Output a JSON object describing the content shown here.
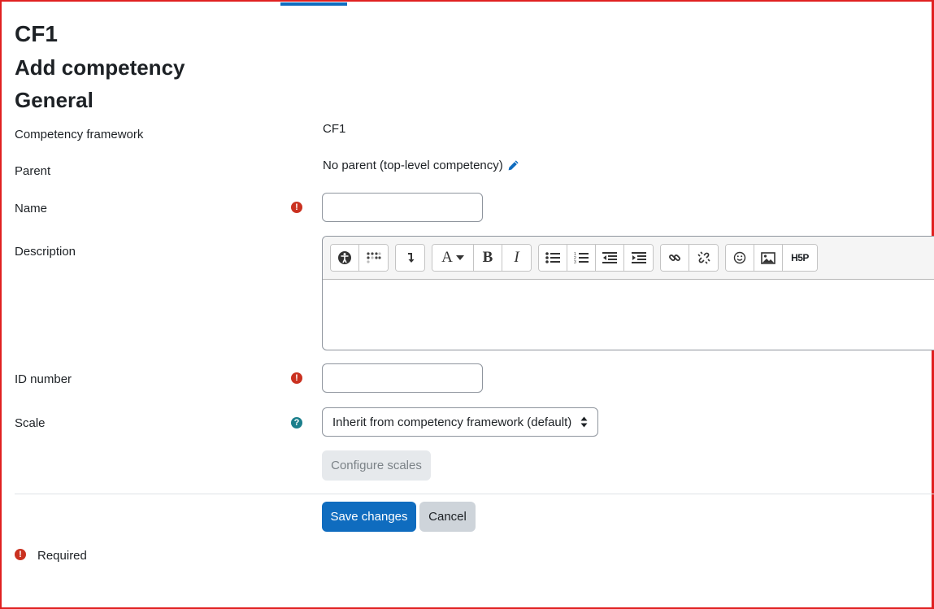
{
  "page": {
    "heading": "CF1",
    "subheading": "Add competency",
    "section": "General"
  },
  "form": {
    "framework": {
      "label": "Competency framework",
      "value": "CF1"
    },
    "parent": {
      "label": "Parent",
      "value": "No parent (top-level competency)",
      "edit_icon": "pencil-icon"
    },
    "name": {
      "label": "Name",
      "value": "",
      "placeholder": ""
    },
    "description": {
      "label": "Description",
      "value": ""
    },
    "idnumber": {
      "label": "ID number",
      "value": "",
      "placeholder": ""
    },
    "scale": {
      "label": "Scale",
      "selected": "Inherit from competency framework (default)"
    },
    "configure_scales": "Configure scales",
    "save": "Save changes",
    "cancel": "Cancel",
    "required_legend": "Required",
    "required_icon": "!",
    "help_icon": "?"
  },
  "toolbar": {
    "groups": [
      [
        "accessibility-checker-icon",
        "screenreader-helper-icon"
      ],
      [
        "show-more-icon"
      ],
      [
        "font-style-icon",
        "bold-icon",
        "italic-icon"
      ],
      [
        "unordered-list-icon",
        "ordered-list-icon",
        "outdent-icon",
        "indent-icon"
      ],
      [
        "link-icon",
        "unlink-icon"
      ],
      [
        "emoji-icon",
        "image-icon",
        "h5p-icon"
      ]
    ],
    "bold_glyph": "B",
    "italic_glyph": "I",
    "font_glyph": "A",
    "h5p_glyph": "H5P"
  },
  "colors": {
    "primary": "#0f6cbf",
    "required": "#ca3120",
    "help": "#1b7f8c",
    "frame": "#e02020"
  }
}
